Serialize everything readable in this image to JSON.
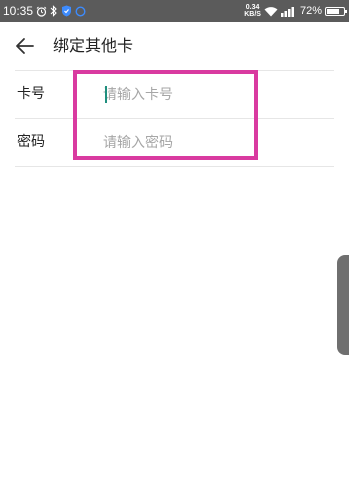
{
  "status_bar": {
    "time": "10:35",
    "net_speed_value": "0.34",
    "net_speed_unit": "KB/S",
    "signal_label": "4G",
    "battery_percent": "72%",
    "battery_level": 0.72,
    "icons": [
      "alarm-icon",
      "bluetooth-icon",
      "shield-icon",
      "app-icon",
      "wifi-icon",
      "signal-icon",
      "battery-icon"
    ]
  },
  "header": {
    "title": "绑定其他卡",
    "back_icon": "back-arrow-icon"
  },
  "form": {
    "rows": [
      {
        "label": "卡号",
        "placeholder": "请输入卡号",
        "value": ""
      },
      {
        "label": "密码",
        "placeholder": "请输入密码",
        "value": ""
      }
    ]
  },
  "colors": {
    "status_bar_bg": "#5b5b5b",
    "highlight": "#d93aa0",
    "cursor": "#1f8f7e",
    "divider": "#e6e6e6",
    "placeholder": "#a6a6a6"
  }
}
